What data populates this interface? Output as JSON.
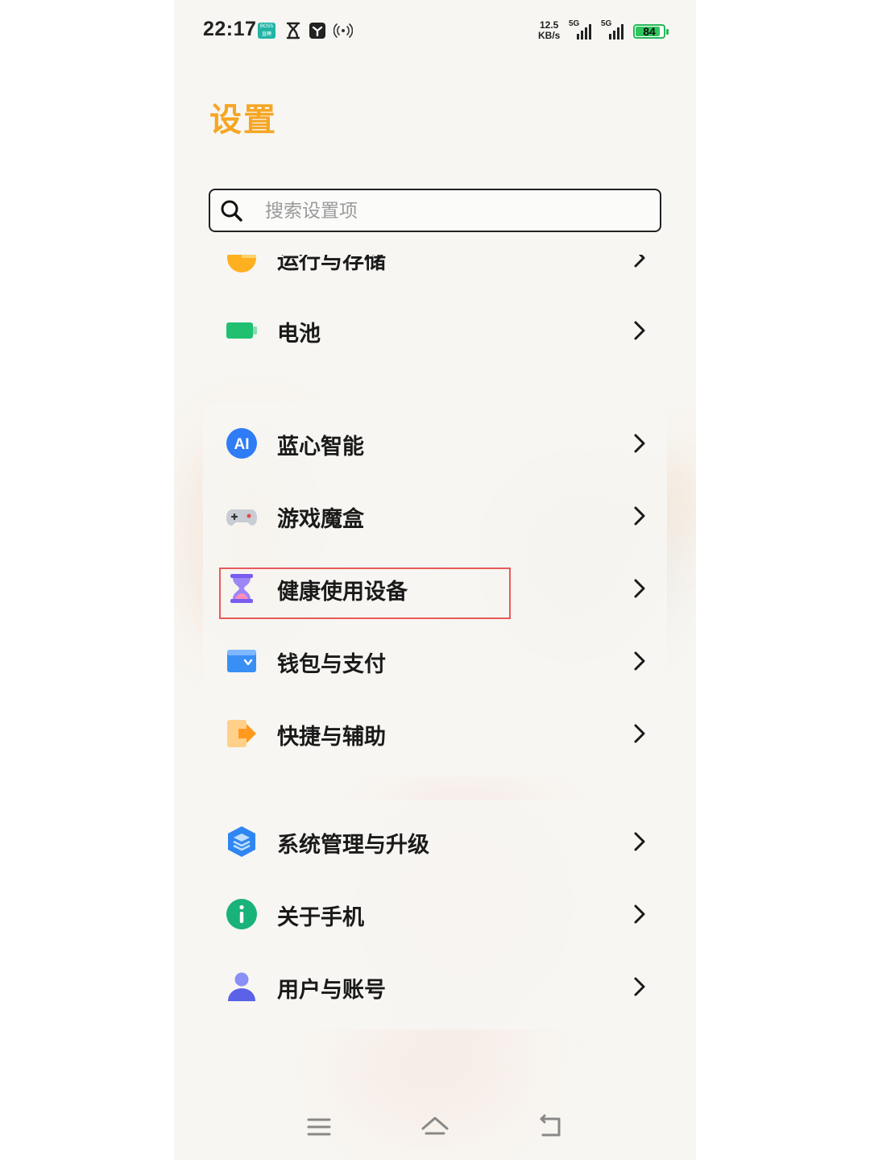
{
  "status_bar": {
    "time": "22:17",
    "boss_icon_label": "BOSS直聘",
    "net_speed": "12.5",
    "net_speed_unit": "KB/s",
    "signal_1_type": "5G",
    "signal_2_type": "5G",
    "battery_level": "84",
    "icons": [
      "boss-zhipin-icon",
      "hourglass-icon",
      "app-icon",
      "hotspot-icon",
      "signal-icon",
      "battery-icon"
    ]
  },
  "header": {
    "title": "设置",
    "title_color": "#f5a623",
    "search_placeholder": "搜索设置项"
  },
  "groups": [
    {
      "items": [
        {
          "label": "运行与存储",
          "icon": "storage-pie-icon",
          "color": "#ffb020"
        },
        {
          "label": "电池",
          "icon": "battery-icon",
          "color": "#20c070"
        }
      ]
    },
    {
      "items": [
        {
          "label": "蓝心智能",
          "icon": "ai-icon",
          "color": "#2f7cf6"
        },
        {
          "label": "游戏魔盒",
          "icon": "gamepad-icon",
          "color": "#9aa0aa"
        },
        {
          "label": "健康使用设备",
          "icon": "hourglass-icon",
          "color": "#7a5cf0"
        },
        {
          "label": "钱包与支付",
          "icon": "wallet-icon",
          "color": "#3a8ff5"
        },
        {
          "label": "快捷与辅助",
          "icon": "shortcut-icon",
          "color": "#ffa530"
        }
      ]
    },
    {
      "items": [
        {
          "label": "系统管理与升级",
          "icon": "system-layers-icon",
          "color": "#2f86f0"
        },
        {
          "label": "关于手机",
          "icon": "info-icon",
          "color": "#19b37a"
        },
        {
          "label": "用户与账号",
          "icon": "user-icon",
          "color": "#5b62e8"
        }
      ]
    }
  ],
  "highlighted_item": "健康使用设备",
  "highlight_color": "#e85a5a",
  "nav_bar": {
    "icons": [
      "menu-icon",
      "home-icon",
      "back-icon"
    ]
  }
}
